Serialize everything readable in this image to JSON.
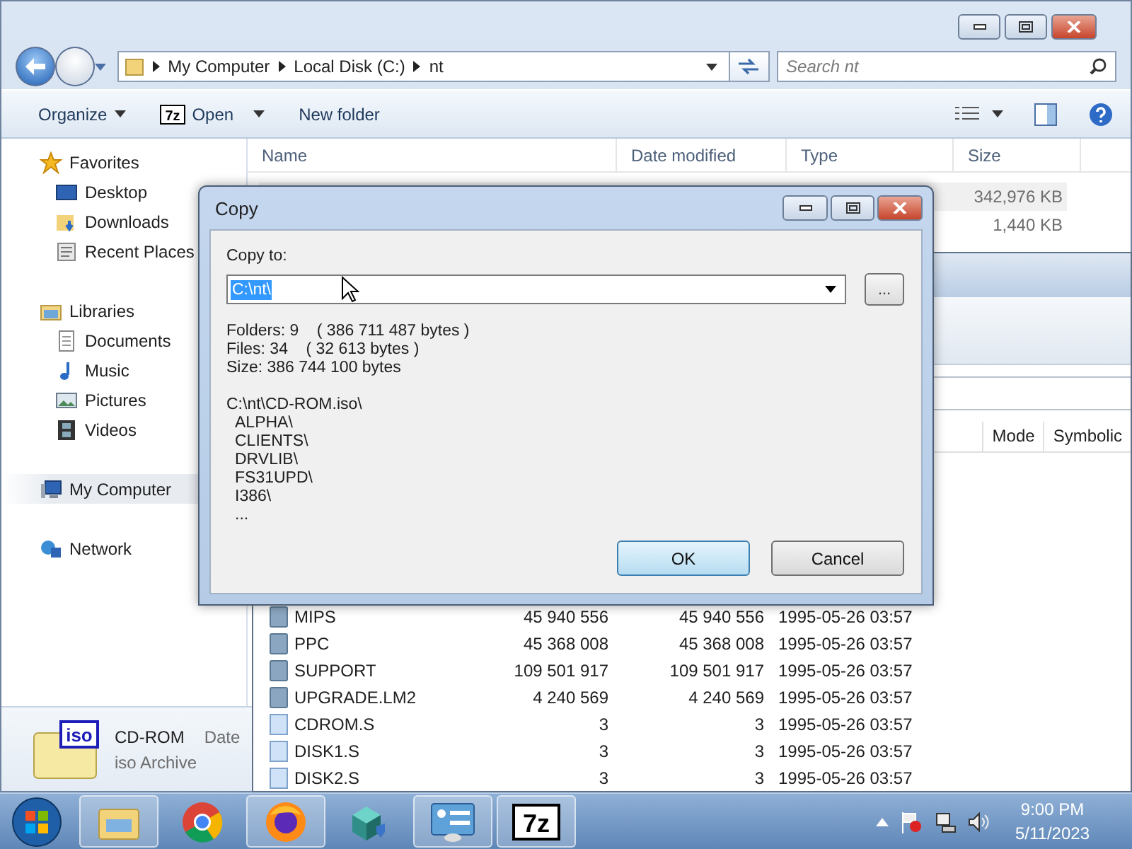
{
  "explorer": {
    "breadcrumbs": [
      "My Computer",
      "Local Disk (C:)",
      "nt"
    ],
    "search_placeholder": "Search nt",
    "toolbar": [
      {
        "label": "Organize",
        "kind": "menu"
      },
      {
        "label": "Open",
        "kind": "open",
        "logo": "7z"
      },
      {
        "label": "New folder",
        "kind": "plain"
      }
    ],
    "nav": [
      {
        "label": "Favorites",
        "kind": "star",
        "selected": false,
        "children": [
          {
            "label": "Desktop",
            "kind": "desktop",
            "selected": false
          },
          {
            "label": "Downloads",
            "kind": "downloads",
            "selected": false
          },
          {
            "label": "Recent Places",
            "kind": "recent",
            "selected": false
          }
        ]
      },
      {
        "label": "Libraries",
        "kind": "library",
        "selected": false,
        "children": [
          {
            "label": "Documents",
            "kind": "documents",
            "selected": false
          },
          {
            "label": "Music",
            "kind": "music",
            "selected": false
          },
          {
            "label": "Pictures",
            "kind": "pictures",
            "selected": false
          },
          {
            "label": "Videos",
            "kind": "videos",
            "selected": false
          }
        ]
      },
      {
        "label": "My Computer",
        "kind": "computer",
        "selected": true
      },
      {
        "label": "Network",
        "kind": "network",
        "selected": false
      }
    ],
    "columns": [
      "Name",
      "Date modified",
      "Type",
      "Size"
    ],
    "rows": [
      {
        "size": "342,976 KB",
        "selected": true
      },
      {
        "size": "1,440 KB",
        "selected": false
      }
    ],
    "details": {
      "badge": "iso",
      "name": "CD-ROM",
      "field": "Date",
      "type": "iso Archive"
    }
  },
  "archive": {
    "columns": [
      "Mode",
      "Symbolic"
    ],
    "rows": [
      {
        "name": "MIPS",
        "kind": "folder",
        "size": "45 940 556",
        "packed": "45 940 556",
        "modified": "1995-05-26 03:57"
      },
      {
        "name": "PPC",
        "kind": "folder",
        "size": "45 368 008",
        "packed": "45 368 008",
        "modified": "1995-05-26 03:57"
      },
      {
        "name": "SUPPORT",
        "kind": "folder",
        "size": "109 501 917",
        "packed": "109 501 917",
        "modified": "1995-05-26 03:57"
      },
      {
        "name": "UPGRADE.LM2",
        "kind": "folder",
        "size": "4 240 569",
        "packed": "4 240 569",
        "modified": "1995-05-26 03:57"
      },
      {
        "name": "CDROM.S",
        "kind": "file",
        "size": "3",
        "packed": "3",
        "modified": "1995-05-26 03:57"
      },
      {
        "name": "DISK1.S",
        "kind": "file",
        "size": "3",
        "packed": "3",
        "modified": "1995-05-26 03:57"
      },
      {
        "name": "DISK2.S",
        "kind": "file",
        "size": "3",
        "packed": "3",
        "modified": "1995-05-26 03:57"
      }
    ]
  },
  "dialog": {
    "title": "Copy",
    "label": "Copy to:",
    "path": {
      "value": "C:\\nt\\",
      "selected": true
    },
    "browse": "...",
    "info": [
      "Folders: 9    ( 386 711 487 bytes )",
      "Files: 34    ( 32 613 bytes )",
      "Size: 386 744 100 bytes"
    ],
    "listing": {
      "root": "C:\\nt\\CD-ROM.iso\\",
      "items": [
        "ALPHA\\",
        "CLIENTS\\",
        "DRVLIB\\",
        "FS31UPD\\",
        "I386\\",
        "..."
      ]
    },
    "buttons": [
      {
        "label": "OK",
        "selected": true
      },
      {
        "label": "Cancel",
        "selected": false
      }
    ]
  },
  "taskbar": {
    "apps": [
      {
        "kind": "explorer",
        "running": true
      },
      {
        "kind": "chrome",
        "running": false
      },
      {
        "kind": "firefox",
        "running": true
      },
      {
        "kind": "cube",
        "running": false
      },
      {
        "kind": "panel",
        "running": true
      },
      {
        "kind": "sevenzip",
        "running": true,
        "logo": "7z"
      }
    ],
    "time": "9:00 PM",
    "date": "5/11/2023"
  }
}
